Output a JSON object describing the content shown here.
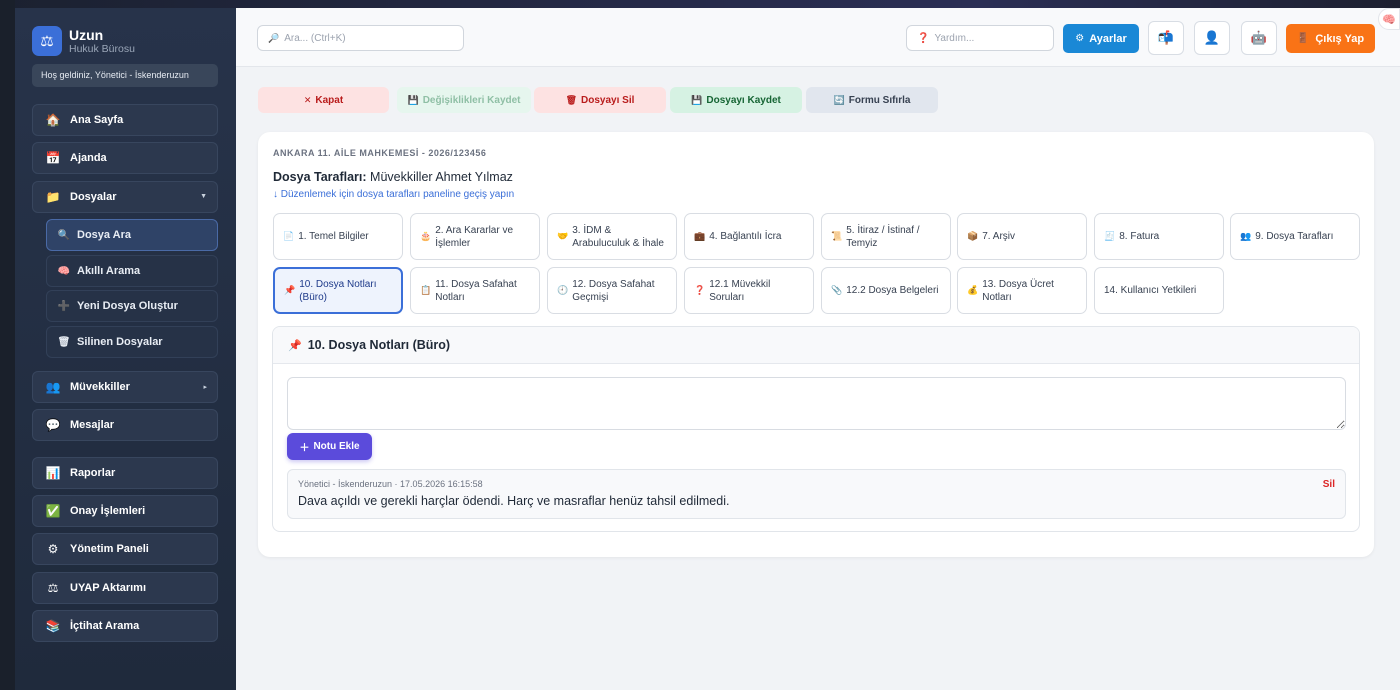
{
  "brand": {
    "title": "Uzun",
    "subtitle": "Hukuk Bürosu",
    "logo_icon": "scales-icon"
  },
  "welcome": "Hoş geldiniz, Yönetici - İskenderuzun",
  "sidebar": {
    "items": [
      {
        "label": "Ana Sayfa",
        "icon": "🏠"
      },
      {
        "label": "Ajanda",
        "icon": "📅"
      },
      {
        "label": "Dosyalar",
        "icon": "📁"
      },
      {
        "label": "Dosya Ara",
        "icon": "🔍"
      },
      {
        "label": "Akıllı Arama",
        "icon": "🧠"
      },
      {
        "label": "Yeni Dosya Oluştur",
        "icon": "➕"
      },
      {
        "label": "Silinen Dosyalar",
        "icon": "🗑"
      },
      {
        "label": "Müvekkiller",
        "icon": "👥"
      },
      {
        "label": "Mesajlar",
        "icon": "💬"
      },
      {
        "label": "Raporlar",
        "icon": "📊"
      },
      {
        "label": "Onay İşlemleri",
        "icon": "✅"
      },
      {
        "label": "Yönetim Paneli",
        "icon": "⚙"
      },
      {
        "label": "UYAP Aktarımı",
        "icon": "⚖"
      },
      {
        "label": "İçtihat Arama",
        "icon": "📚"
      }
    ]
  },
  "header": {
    "search_placeholder": "Ara... (Ctrl+K)",
    "help_placeholder": "Yardım...",
    "settings_label": "Ayarlar",
    "logout_label": "Çıkış Yap"
  },
  "actions": {
    "close": "Kapat",
    "save_changes": "Değişiklikleri Kaydet",
    "delete_file": "Dosyayı Sil",
    "save_file": "Dosyayı Kaydet",
    "reset_form": "Formu Sıfırla"
  },
  "file": {
    "court": "ANKARA 11. AİLE MAHKEMESİ - 2026/123456",
    "parties_label": "Dosya Tarafları:",
    "parties_value": "Müvekkiller Ahmet Yılmaz",
    "edit_hint": "↓ Düzenlemek için dosya tarafları paneline geçiş yapın"
  },
  "tabs": [
    {
      "label": "1. Temel Bilgiler",
      "icon": "📄"
    },
    {
      "label": "2. Ara Kararlar ve İşlemler",
      "icon": "🎂"
    },
    {
      "label": "3. İDM & Arabuluculuk & İhale",
      "icon": "🤝"
    },
    {
      "label": "4. Bağlantılı İcra",
      "icon": "💼"
    },
    {
      "label": "5. İtiraz / İstinaf / Temyiz",
      "icon": "📜"
    },
    {
      "label": "7. Arşiv",
      "icon": "📦"
    },
    {
      "label": "8. Fatura",
      "icon": "🧾"
    },
    {
      "label": "9. Dosya Tarafları",
      "icon": "👥"
    },
    {
      "label": "10. Dosya Notları (Büro)",
      "icon": "📌"
    },
    {
      "label": "11. Dosya Safahat Notları",
      "icon": "📋"
    },
    {
      "label": "12. Dosya Safahat Geçmişi",
      "icon": "🕘"
    },
    {
      "label": "12.1 Müvekkil Soruları",
      "icon": "❓"
    },
    {
      "label": "12.2 Dosya Belgeleri",
      "icon": "📎"
    },
    {
      "label": "13. Dosya Ücret Notları",
      "icon": "💰"
    },
    {
      "label": "14. Kullanıcı Yetkileri",
      "icon": ""
    }
  ],
  "notes_section": {
    "title": "10. Dosya Notları (Büro)",
    "textarea_value": "",
    "add_button": "Notu Ekle",
    "note": {
      "meta": "Yönetici - İskenderuzun · 17.05.2026 16:15:58",
      "text": "Dava açıldı ve gerekli harçlar ödendi. Harç ve masraflar henüz tahsil edilmedi.",
      "delete": "Sil"
    }
  },
  "colors": {
    "primary": "#3b6fd8",
    "settings": "#1a88d6",
    "logout": "#f97316",
    "add_note": "#5b4bdb",
    "delete": "#dc2626"
  }
}
